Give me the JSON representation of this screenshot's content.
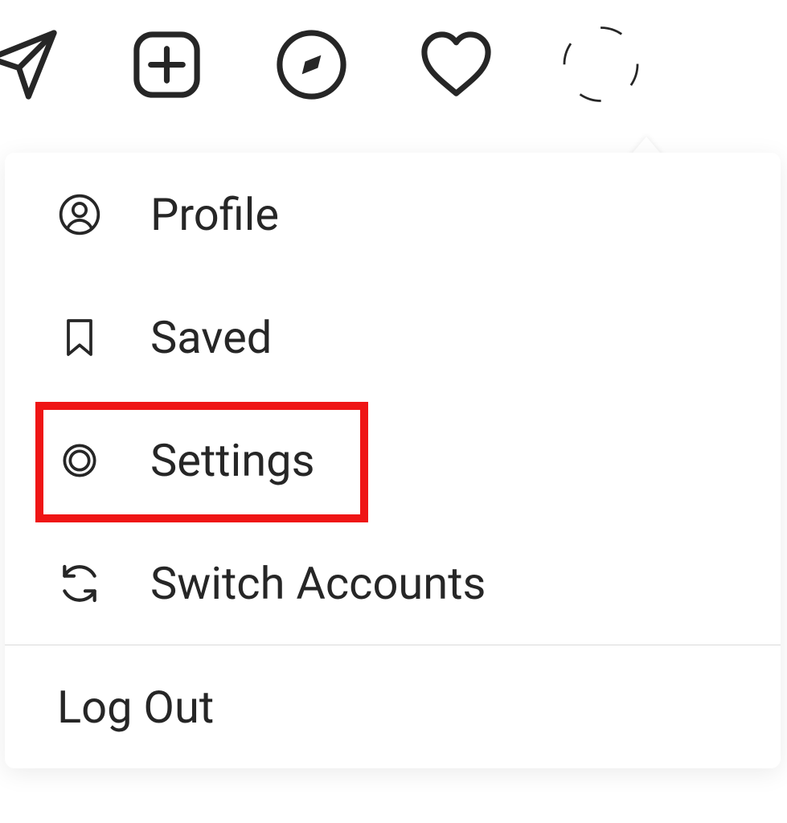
{
  "nav": {
    "icons": [
      "send",
      "new-post",
      "explore",
      "activity",
      "avatar"
    ]
  },
  "menu": {
    "items": [
      {
        "id": "profile",
        "label": "Profile",
        "icon": "user-circle"
      },
      {
        "id": "saved",
        "label": "Saved",
        "icon": "bookmark"
      },
      {
        "id": "settings",
        "label": "Settings",
        "icon": "gear"
      },
      {
        "id": "switch",
        "label": "Switch Accounts",
        "icon": "swap"
      }
    ],
    "logout_label": "Log Out"
  },
  "highlight": {
    "target": "settings"
  }
}
